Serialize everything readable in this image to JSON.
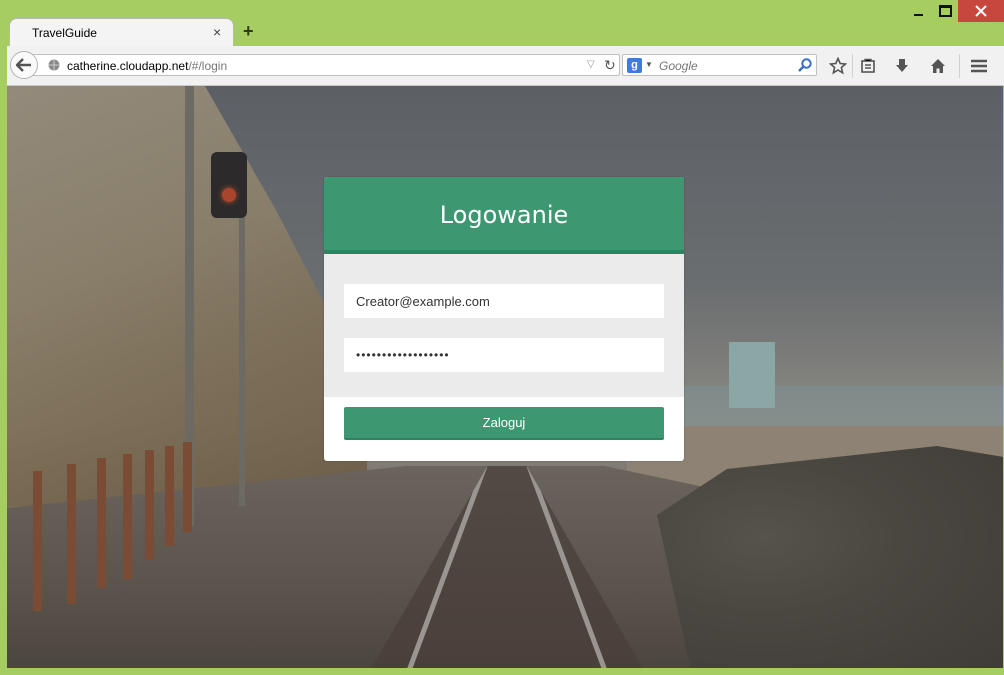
{
  "browser": {
    "tab_title": "TravelGuide",
    "tab_close": "×",
    "new_tab": "+",
    "url_host": "catherine.cloudapp.net",
    "url_path": "/#/login",
    "search_placeholder": "Google",
    "search_engine_letter": "g"
  },
  "login": {
    "title": "Logowanie",
    "email_value": "Creator@example.com",
    "password_value": "••••••••••••••••••",
    "submit_label": "Zaloguj"
  },
  "colors": {
    "accent": "#3d9872",
    "window_frame": "#a6cd62",
    "close_button": "#c7463e"
  }
}
